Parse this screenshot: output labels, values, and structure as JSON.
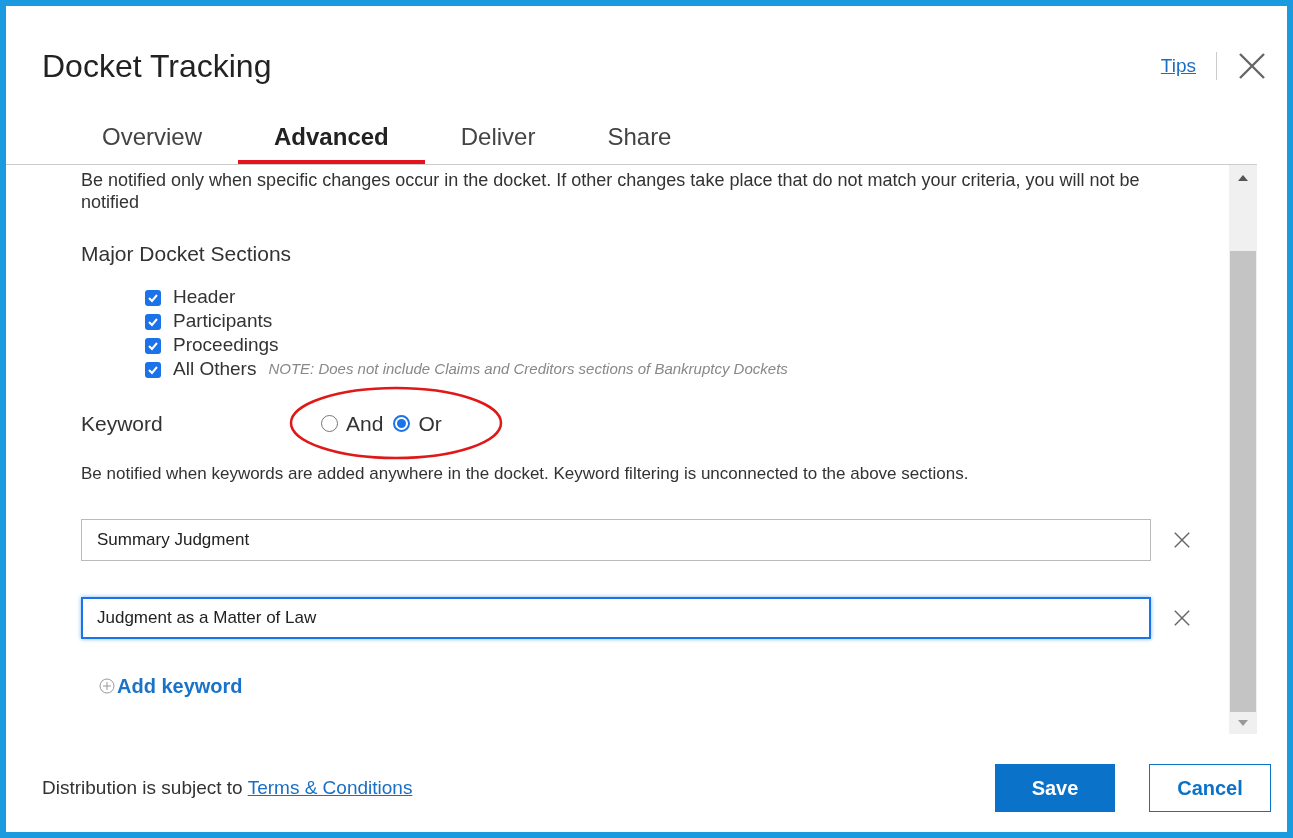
{
  "dialog": {
    "title": "Docket Tracking",
    "tips_link": "Tips"
  },
  "tabs": [
    {
      "label": "Overview",
      "selected": false
    },
    {
      "label": "Advanced",
      "selected": true
    },
    {
      "label": "Deliver",
      "selected": false
    },
    {
      "label": "Share",
      "selected": false
    }
  ],
  "intro": "Be notified only when specific changes occur in the docket. If other changes take place that do not match your criteria, you will not be notified",
  "sections": {
    "heading": "Major Docket Sections",
    "items": [
      {
        "label": "Header",
        "checked": true
      },
      {
        "label": "Participants",
        "checked": true
      },
      {
        "label": "Proceedings",
        "checked": true
      },
      {
        "label": "All Others",
        "checked": true,
        "note": "NOTE: Does not include Claims and Creditors sections of Bankruptcy Dockets"
      }
    ]
  },
  "keyword": {
    "heading": "Keyword",
    "options": [
      {
        "label": "And",
        "selected": false
      },
      {
        "label": "Or",
        "selected": true
      }
    ],
    "description": "Be notified when keywords are added anywhere in the docket. Keyword filtering is unconnected to the above sections.",
    "fields": [
      {
        "value": "Summary Judgment",
        "focused": false
      },
      {
        "value": "Judgment as a Matter of Law",
        "focused": true
      }
    ],
    "add_label": "Add keyword"
  },
  "footer": {
    "text": "Distribution is subject to",
    "link": "Terms & Conditions",
    "buttons": [
      "Save",
      "Cancel"
    ]
  }
}
